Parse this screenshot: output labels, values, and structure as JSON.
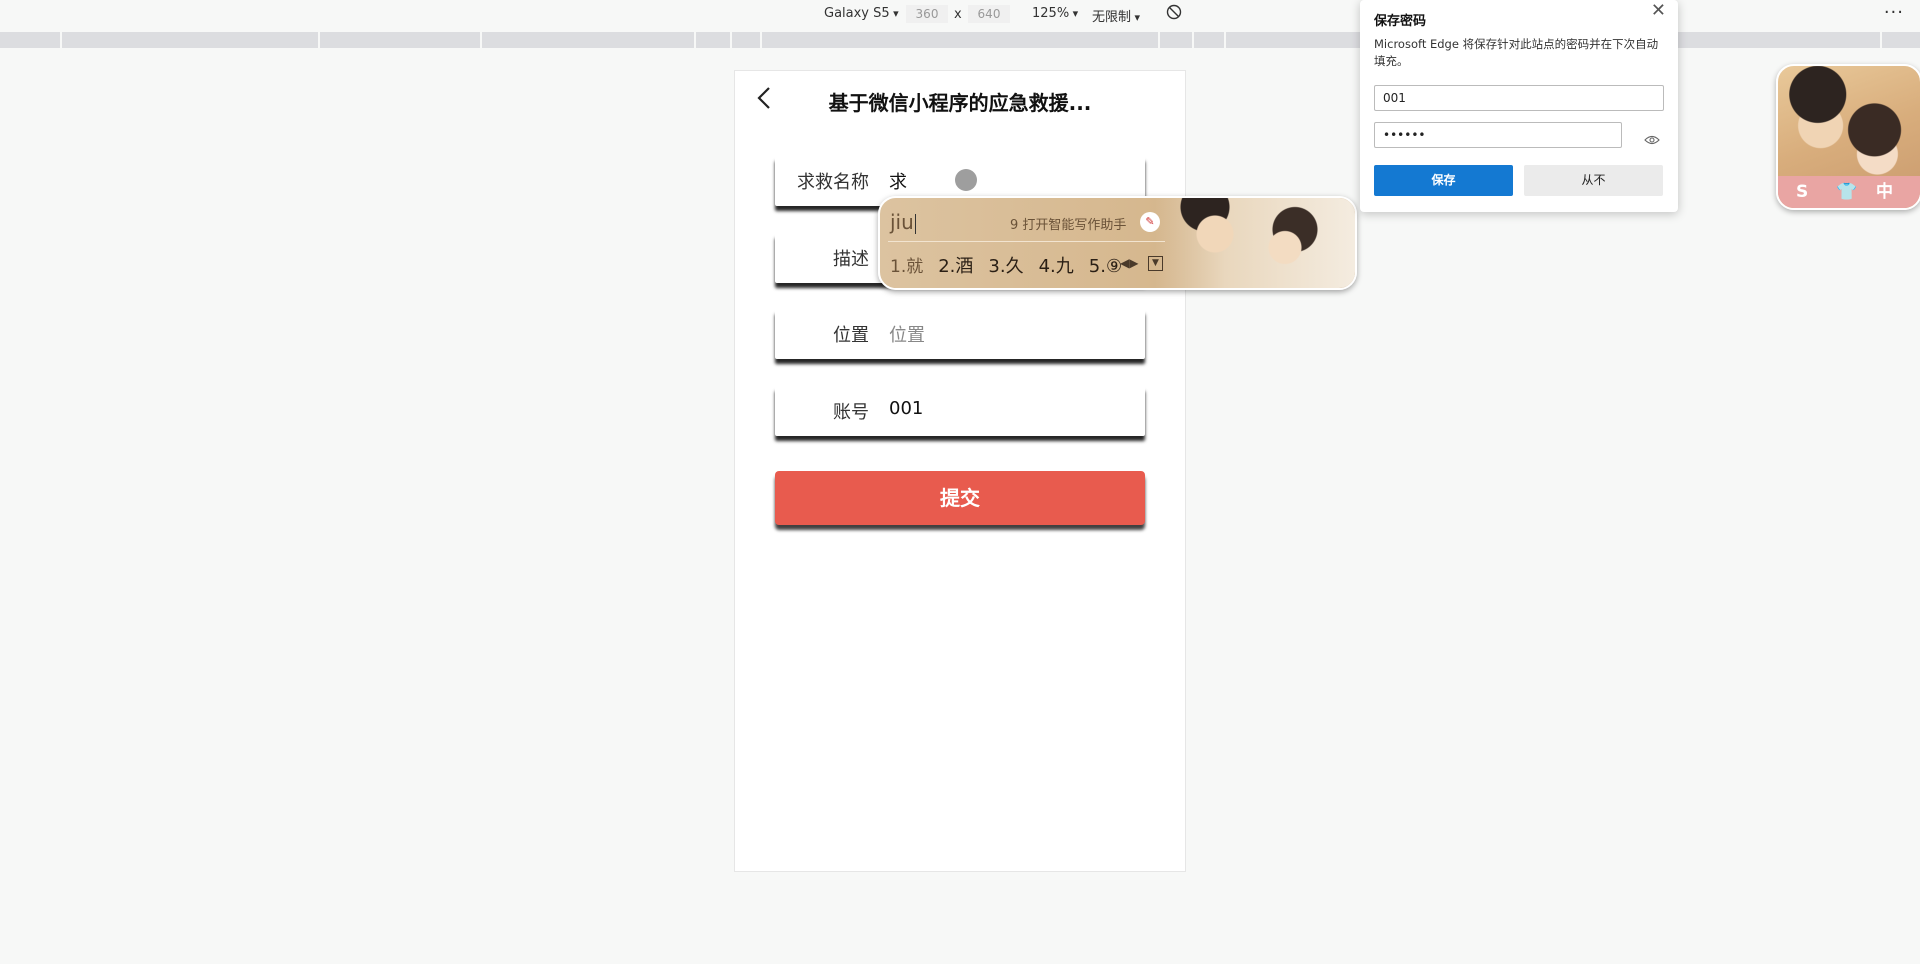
{
  "devtools": {
    "device": "Galaxy S5",
    "width": "360",
    "height": "640",
    "times": "x",
    "zoom": "125%",
    "throttle": "无限制"
  },
  "app": {
    "title": "基于微信小程序的应急救援...",
    "fields": [
      {
        "label": "求救名称",
        "value": "求",
        "placeholder": ""
      },
      {
        "label": "描述",
        "value": "",
        "placeholder": ""
      },
      {
        "label": "位置",
        "value": "",
        "placeholder": "位置"
      },
      {
        "label": "账号",
        "value": "001",
        "placeholder": ""
      }
    ],
    "submit_label": "提交",
    "submit_color": "#e85b4e"
  },
  "ime": {
    "pinyin": "jiu",
    "assistant_text": "9 打开智能写作助手",
    "candidates": [
      "1.就",
      "2.酒",
      "3.久",
      "4.九",
      "5.⑨"
    ]
  },
  "password_popup": {
    "title": "保存密码",
    "description": "Microsoft Edge 将保存针对此站点的密码并在下次自动填充。",
    "username": "001",
    "password": "••••••",
    "save_label": "保存",
    "never_label": "从不",
    "accent": "#1479d2"
  },
  "ime_badge": {
    "icons": [
      "S",
      "👕",
      "中"
    ]
  }
}
